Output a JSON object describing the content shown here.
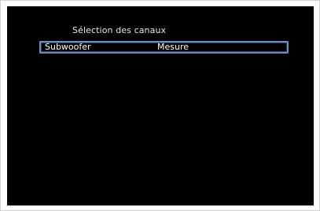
{
  "menu": {
    "title": "Sélection des canaux",
    "items": [
      {
        "label": "Subwoofer",
        "value": "Mesure"
      }
    ]
  },
  "colors": {
    "background": "#000000",
    "text": "#ffffff",
    "highlight_border": "#6f8fc4"
  }
}
